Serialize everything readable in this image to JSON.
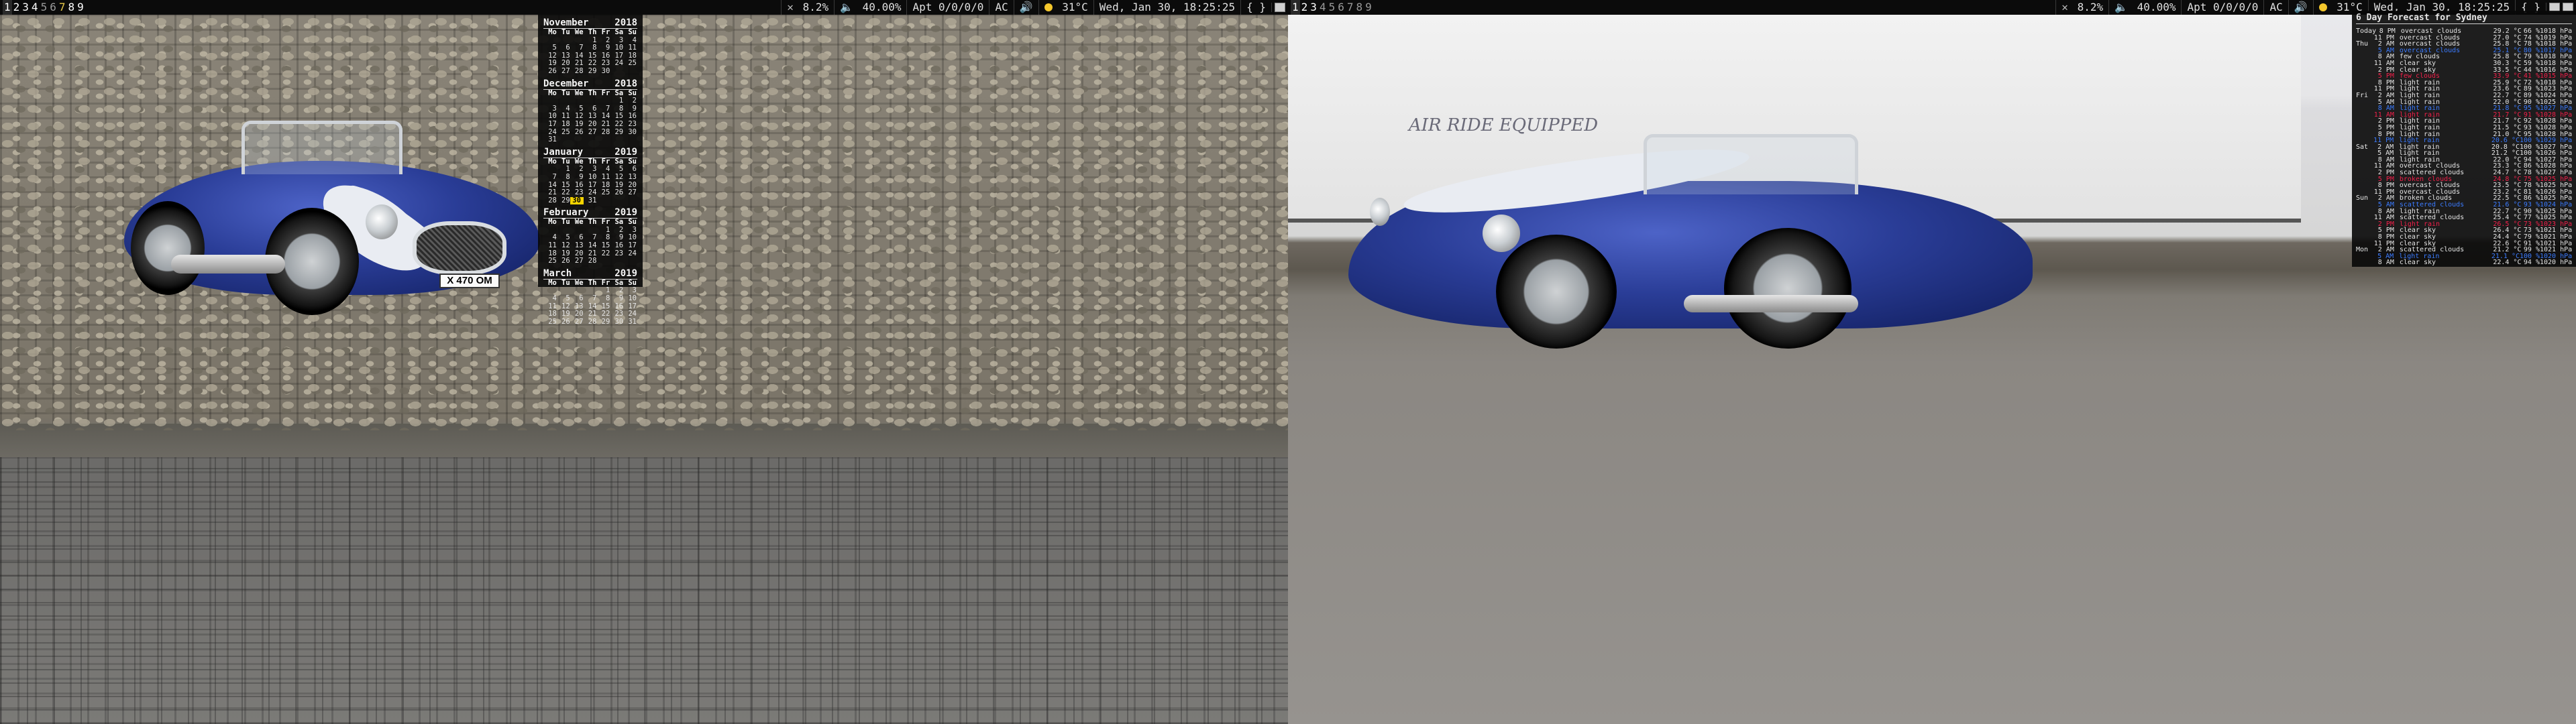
{
  "workspaces": [
    "1",
    "2",
    "3",
    "4",
    "5",
    "6",
    "7",
    "8",
    "9"
  ],
  "bar": {
    "left": {
      "close_icon": "✕",
      "battery_pct": "8.2%",
      "volume_icon": "🔈",
      "volume_pct": "40.00%",
      "network": "Apt 0/0/0/0",
      "power": "AC",
      "speaker_icon": "🔊",
      "weather_temp": "31°C",
      "datetime": "Wed, Jan 30, 18:25:25",
      "brackets": "{ }"
    },
    "right": {
      "close_icon": "✕",
      "battery_pct": "8.2%",
      "volume_icon": "🔈",
      "volume_pct": "40.00%",
      "network": "Apt 0/0/0/0",
      "power": "AC",
      "speaker_icon": "🔊",
      "weather_temp": "31°C",
      "datetime": "Wed, Jan 30, 18:25:25",
      "brackets": "{ }"
    }
  },
  "calendar": {
    "weekdays": [
      "Mo",
      "Tu",
      "We",
      "Th",
      "Fr",
      "Sa",
      "Su"
    ],
    "today": "30",
    "months": [
      {
        "name": "November",
        "year": "2018",
        "offset": 3,
        "days": 30,
        "today": null
      },
      {
        "name": "December",
        "year": "2018",
        "offset": 5,
        "days": 31,
        "today": null
      },
      {
        "name": "January",
        "year": "2019",
        "offset": 1,
        "days": 31,
        "today": 30
      },
      {
        "name": "February",
        "year": "2019",
        "offset": 4,
        "days": 28,
        "today": null
      },
      {
        "name": "March",
        "year": "2019",
        "offset": 4,
        "days": 31,
        "today": null
      }
    ]
  },
  "forecast": {
    "title": "6 Day Forecast for Sydney",
    "rows": [
      {
        "day": "Today",
        "time": "8 PM",
        "cond": "overcast clouds",
        "temp": "29.2 °C",
        "hum": "66 %",
        "pres": "1018 hPa",
        "hl": ""
      },
      {
        "day": "",
        "time": "11 PM",
        "cond": "overcast clouds",
        "temp": "27.0 °C",
        "hum": "74 %",
        "pres": "1019 hPa",
        "hl": ""
      },
      {
        "day": "Thu",
        "time": "2 AM",
        "cond": "overcast clouds",
        "temp": "25.8 °C",
        "hum": "78 %",
        "pres": "1018 hPa",
        "hl": ""
      },
      {
        "day": "",
        "time": "5 AM",
        "cond": "overcast clouds",
        "temp": "25.1 °C",
        "hum": "80 %",
        "pres": "1017 hPa",
        "hl": "blue"
      },
      {
        "day": "",
        "time": "8 AM",
        "cond": "few clouds",
        "temp": "25.8 °C",
        "hum": "79 %",
        "pres": "1018 hPa",
        "hl": ""
      },
      {
        "day": "",
        "time": "11 AM",
        "cond": "clear sky",
        "temp": "30.3 °C",
        "hum": "59 %",
        "pres": "1018 hPa",
        "hl": ""
      },
      {
        "day": "",
        "time": "2 PM",
        "cond": "clear sky",
        "temp": "33.5 °C",
        "hum": "44 %",
        "pres": "1016 hPa",
        "hl": ""
      },
      {
        "day": "",
        "time": "5 PM",
        "cond": "few clouds",
        "temp": "33.9 °C",
        "hum": "41 %",
        "pres": "1015 hPa",
        "hl": "red"
      },
      {
        "day": "",
        "time": "8 PM",
        "cond": "light rain",
        "temp": "25.9 °C",
        "hum": "72 %",
        "pres": "1018 hPa",
        "hl": ""
      },
      {
        "day": "",
        "time": "11 PM",
        "cond": "light rain",
        "temp": "23.6 °C",
        "hum": "89 %",
        "pres": "1023 hPa",
        "hl": ""
      },
      {
        "day": "Fri",
        "time": "2 AM",
        "cond": "light rain",
        "temp": "22.7 °C",
        "hum": "89 %",
        "pres": "1024 hPa",
        "hl": ""
      },
      {
        "day": "",
        "time": "5 AM",
        "cond": "light rain",
        "temp": "22.0 °C",
        "hum": "90 %",
        "pres": "1025 hPa",
        "hl": ""
      },
      {
        "day": "",
        "time": "8 AM",
        "cond": "light rain",
        "temp": "21.8 °C",
        "hum": "95 %",
        "pres": "1027 hPa",
        "hl": "blue"
      },
      {
        "day": "",
        "time": "11 AM",
        "cond": "light rain",
        "temp": "21.7 °C",
        "hum": "91 %",
        "pres": "1028 hPa",
        "hl": "red"
      },
      {
        "day": "",
        "time": "2 PM",
        "cond": "light rain",
        "temp": "21.7 °C",
        "hum": "92 %",
        "pres": "1028 hPa",
        "hl": ""
      },
      {
        "day": "",
        "time": "5 PM",
        "cond": "light rain",
        "temp": "21.5 °C",
        "hum": "93 %",
        "pres": "1028 hPa",
        "hl": ""
      },
      {
        "day": "",
        "time": "8 PM",
        "cond": "light rain",
        "temp": "21.0 °C",
        "hum": "95 %",
        "pres": "1028 hPa",
        "hl": ""
      },
      {
        "day": "",
        "time": "11 PM",
        "cond": "light rain",
        "temp": "20.6 °C",
        "hum": "100 %",
        "pres": "1029 hPa",
        "hl": "blue"
      },
      {
        "day": "Sat",
        "time": "2 AM",
        "cond": "light rain",
        "temp": "20.8 °C",
        "hum": "100 %",
        "pres": "1027 hPa",
        "hl": ""
      },
      {
        "day": "",
        "time": "5 AM",
        "cond": "light rain",
        "temp": "21.2 °C",
        "hum": "100 %",
        "pres": "1026 hPa",
        "hl": ""
      },
      {
        "day": "",
        "time": "8 AM",
        "cond": "light rain",
        "temp": "22.0 °C",
        "hum": "94 %",
        "pres": "1027 hPa",
        "hl": ""
      },
      {
        "day": "",
        "time": "11 AM",
        "cond": "overcast clouds",
        "temp": "23.3 °C",
        "hum": "86 %",
        "pres": "1028 hPa",
        "hl": ""
      },
      {
        "day": "",
        "time": "2 PM",
        "cond": "scattered clouds",
        "temp": "24.7 °C",
        "hum": "78 %",
        "pres": "1027 hPa",
        "hl": ""
      },
      {
        "day": "",
        "time": "5 PM",
        "cond": "broken clouds",
        "temp": "24.8 °C",
        "hum": "75 %",
        "pres": "1025 hPa",
        "hl": "red"
      },
      {
        "day": "",
        "time": "8 PM",
        "cond": "overcast clouds",
        "temp": "23.5 °C",
        "hum": "78 %",
        "pres": "1025 hPa",
        "hl": ""
      },
      {
        "day": "",
        "time": "11 PM",
        "cond": "overcast clouds",
        "temp": "23.2 °C",
        "hum": "81 %",
        "pres": "1026 hPa",
        "hl": ""
      },
      {
        "day": "Sun",
        "time": "2 AM",
        "cond": "broken clouds",
        "temp": "22.5 °C",
        "hum": "86 %",
        "pres": "1025 hPa",
        "hl": ""
      },
      {
        "day": "",
        "time": "5 AM",
        "cond": "scattered clouds",
        "temp": "21.6 °C",
        "hum": "93 %",
        "pres": "1024 hPa",
        "hl": "blue"
      },
      {
        "day": "",
        "time": "8 AM",
        "cond": "light rain",
        "temp": "22.7 °C",
        "hum": "90 %",
        "pres": "1025 hPa",
        "hl": ""
      },
      {
        "day": "",
        "time": "11 AM",
        "cond": "scattered clouds",
        "temp": "25.4 °C",
        "hum": "77 %",
        "pres": "1025 hPa",
        "hl": ""
      },
      {
        "day": "",
        "time": "2 PM",
        "cond": "light rain",
        "temp": "26.5 °C",
        "hum": "73 %",
        "pres": "1023 hPa",
        "hl": "red"
      },
      {
        "day": "",
        "time": "5 PM",
        "cond": "clear sky",
        "temp": "26.4 °C",
        "hum": "73 %",
        "pres": "1021 hPa",
        "hl": ""
      },
      {
        "day": "",
        "time": "8 PM",
        "cond": "clear sky",
        "temp": "24.4 °C",
        "hum": "79 %",
        "pres": "1021 hPa",
        "hl": ""
      },
      {
        "day": "",
        "time": "11 PM",
        "cond": "clear sky",
        "temp": "22.6 °C",
        "hum": "91 %",
        "pres": "1021 hPa",
        "hl": ""
      },
      {
        "day": "Mon",
        "time": "2 AM",
        "cond": "scattered clouds",
        "temp": "21.2 °C",
        "hum": "99 %",
        "pres": "1021 hPa",
        "hl": ""
      },
      {
        "day": "",
        "time": "5 AM",
        "cond": "light rain",
        "temp": "21.1 °C",
        "hum": "100 %",
        "pres": "1020 hPa",
        "hl": "blue"
      },
      {
        "day": "",
        "time": "8 AM",
        "cond": "clear sky",
        "temp": "22.4 °C",
        "hum": "94 %",
        "pres": "1020 hPa",
        "hl": ""
      }
    ]
  },
  "wallpaper": {
    "left_plate": "X 470 OM",
    "right_trailer_text": "AIR RIDE EQUIPPED"
  },
  "colors": {
    "bar_bg": "#0b0b0b",
    "panel_bg": "#080808",
    "today_highlight": "#f5d400",
    "forecast_blue": "#3b7bff",
    "forecast_red": "#f0204a",
    "weather_sun": "#f4c72c"
  },
  "icons": {
    "close": "close-icon",
    "volume": "volume-icon",
    "speaker": "speaker-icon",
    "sun": "sun-icon",
    "tray": "tray-icon"
  }
}
